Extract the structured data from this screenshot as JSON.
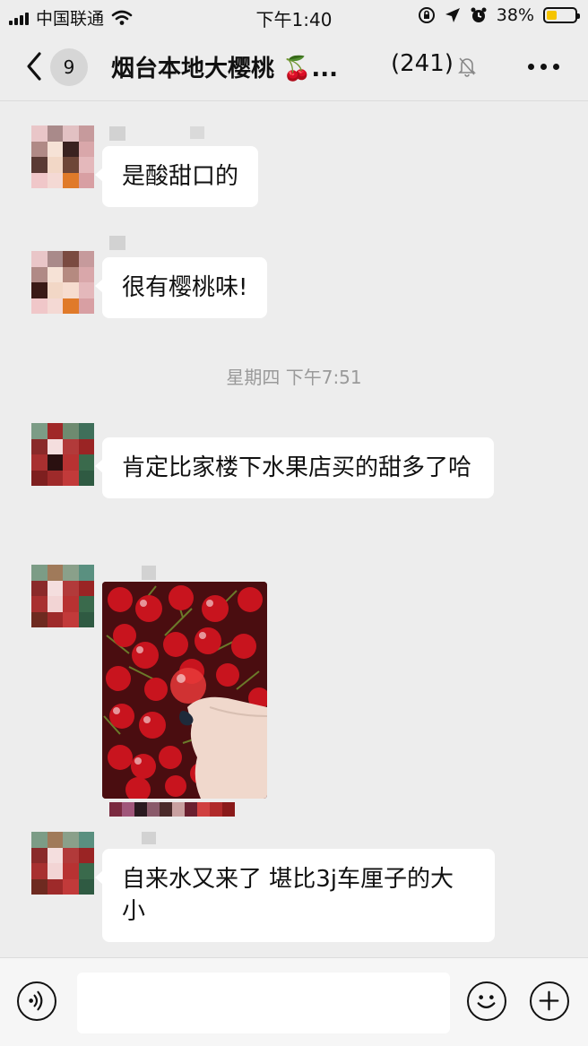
{
  "status_bar": {
    "carrier": "中国联通",
    "time": "下午1:40",
    "battery_percent": "38%",
    "battery_level": 0.38
  },
  "nav": {
    "unread_count": "9",
    "chat_title": "烟台本地大樱桃 🍒...",
    "member_count": "(241)"
  },
  "messages": [
    {
      "type": "text",
      "text": "是酸甜口的"
    },
    {
      "type": "text",
      "text": "很有樱桃味!"
    },
    {
      "type": "time",
      "text": "星期四 下午7:51"
    },
    {
      "type": "text",
      "text": "肯定比家楼下水果店买的甜多了哈"
    },
    {
      "type": "image"
    },
    {
      "type": "text",
      "text": "自来水又来了 堪比3j车厘子的大小"
    }
  ],
  "icons": {
    "back": "chevron-left-icon",
    "mute": "bell-muted-icon",
    "more": "more-dots-icon",
    "voice": "voice-icon",
    "emoji": "emoji-icon",
    "add": "plus-icon"
  }
}
